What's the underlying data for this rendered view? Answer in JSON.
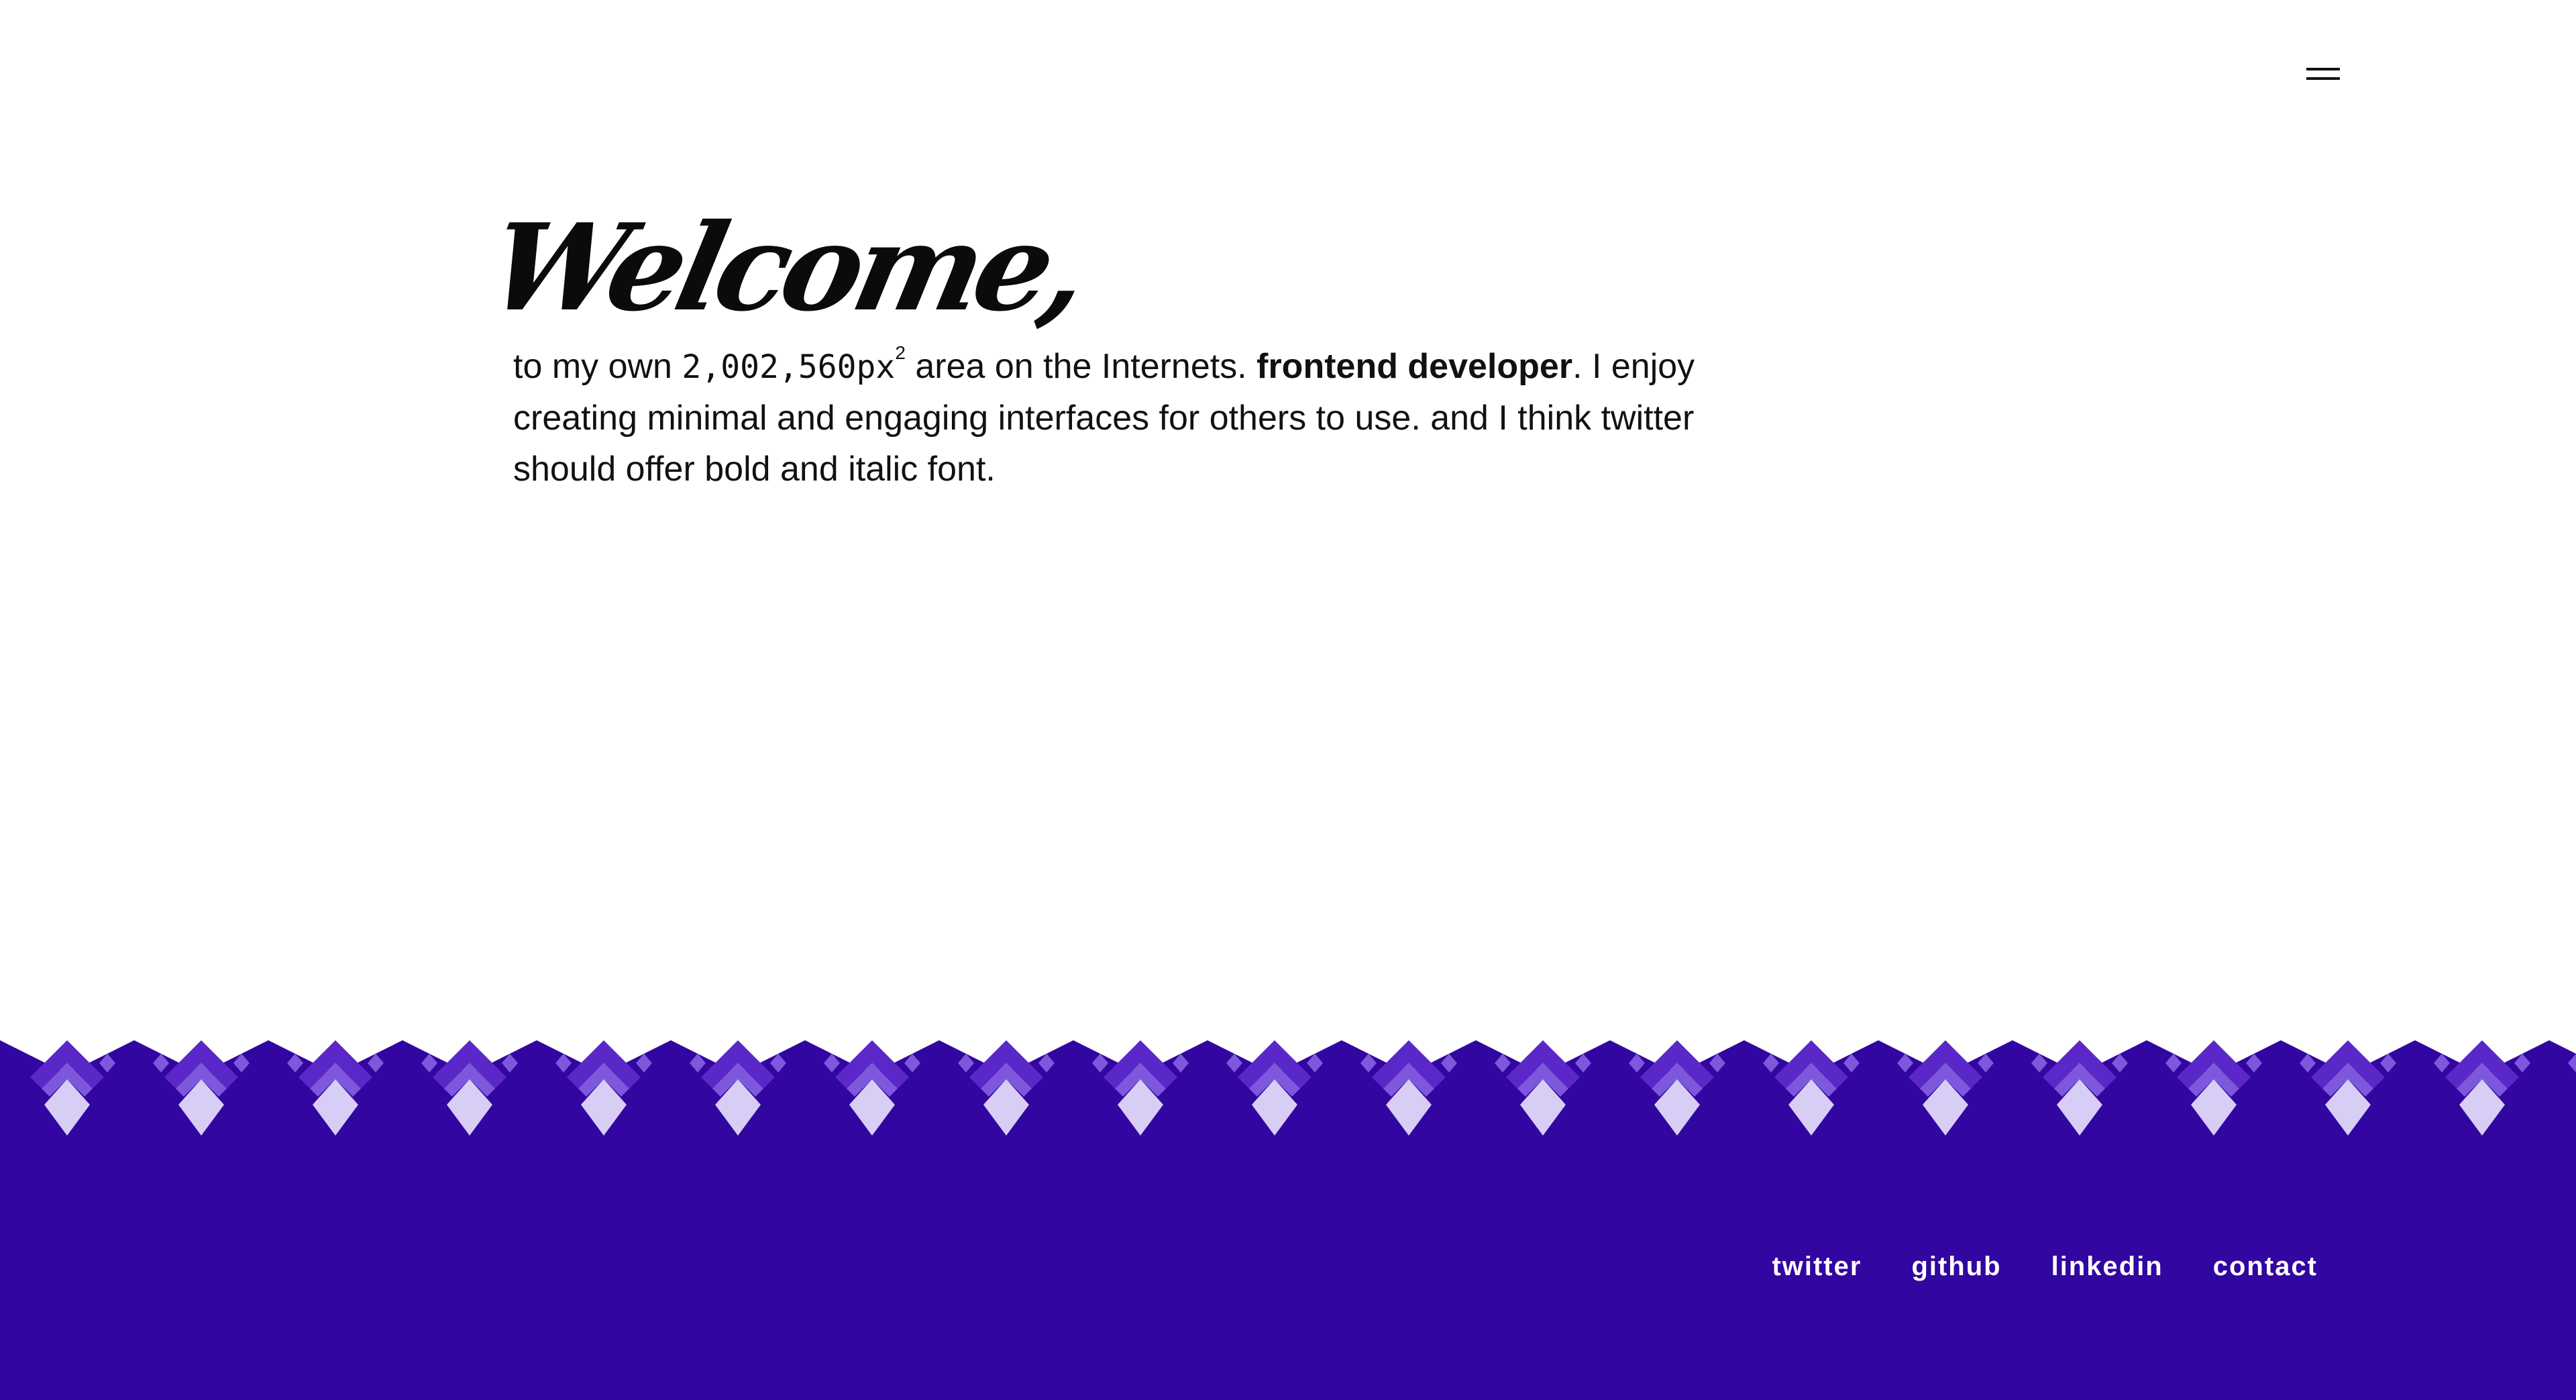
{
  "header": {
    "menu_icon": "hamburger-icon"
  },
  "hero": {
    "title": "Welcome,",
    "intro_prefix": "to my own ",
    "area_value": "2,002,560px",
    "area_superscript": "2",
    "intro_middle": " area on the Internets. ",
    "role": "frontend developer",
    "intro_suffix": ". I enjoy creating minimal and engaging interfaces for others to use. and I think twitter should offer bold and italic font."
  },
  "footer": {
    "links": [
      {
        "label": "twitter"
      },
      {
        "label": "github"
      },
      {
        "label": "linkedin"
      },
      {
        "label": "contact"
      }
    ]
  },
  "colors": {
    "background": "#ffffff",
    "footer_background": "#3206a0",
    "pattern_mid": "#5a28c8",
    "pattern_light": "#7e58dc",
    "pattern_pale": "#d8cdf5",
    "text": "#111111"
  }
}
